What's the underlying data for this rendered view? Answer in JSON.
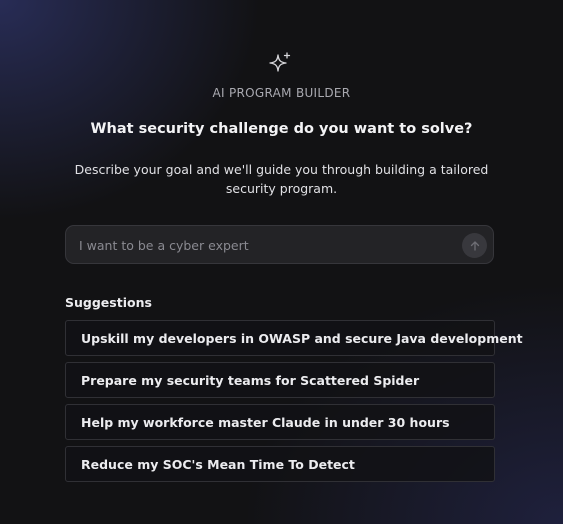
{
  "header": {
    "icon": "sparkles-icon",
    "eyebrow": "AI PROGRAM BUILDER",
    "headline": "What security challenge do you want to solve?",
    "subtitle": "Describe your goal and we'll guide you through building a tailored security program."
  },
  "prompt": {
    "value": "",
    "placeholder": "I want to be a cyber expert",
    "send_icon": "arrow-up-icon"
  },
  "suggestions": {
    "label": "Suggestions",
    "items": [
      "Upskill my developers in OWASP and secure Java development",
      "Prepare my security teams for Scattered Spider",
      "Help my workforce master Claude in under 30 hours",
      "Reduce my SOC's Mean Time To Detect"
    ]
  },
  "colors": {
    "background": "#121214",
    "accent_glow": "#3a428c",
    "input_background": "#232326",
    "border": "#303035"
  }
}
